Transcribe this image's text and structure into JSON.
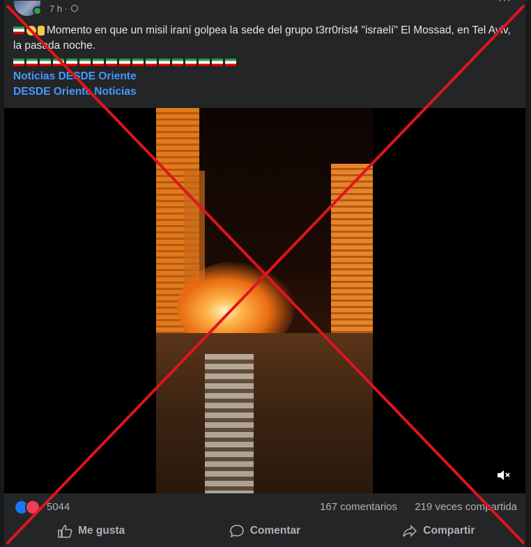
{
  "post": {
    "time": "7 h ·",
    "more": "···",
    "text_line1": "Momento en que un misil iraní golpea la sede del grupo t3rr0rist4 \"israelí\" El Mossad, en Tel Aviv, la pasada noche.",
    "link1": "Noticias DESDE Oriente",
    "link2": "DESDE Oriente Noticias"
  },
  "stats": {
    "reactions": "5044",
    "comments": "167 comentarios",
    "shares": "219 veces compartida"
  },
  "actions": {
    "like": "Me gusta",
    "comment": "Comentar",
    "share": "Compartir"
  },
  "icons": {
    "like": "thumbs-up-icon",
    "comment": "comment-bubble-icon",
    "share": "share-arrow-icon",
    "mute": "speaker-muted-icon"
  },
  "colors": {
    "background": "#242526",
    "link": "#4599ff",
    "text": "#e4e6eb",
    "muted": "#b0b3b8",
    "cross": "#e0141e",
    "like": "#1877f2",
    "love": "#f33e58"
  }
}
